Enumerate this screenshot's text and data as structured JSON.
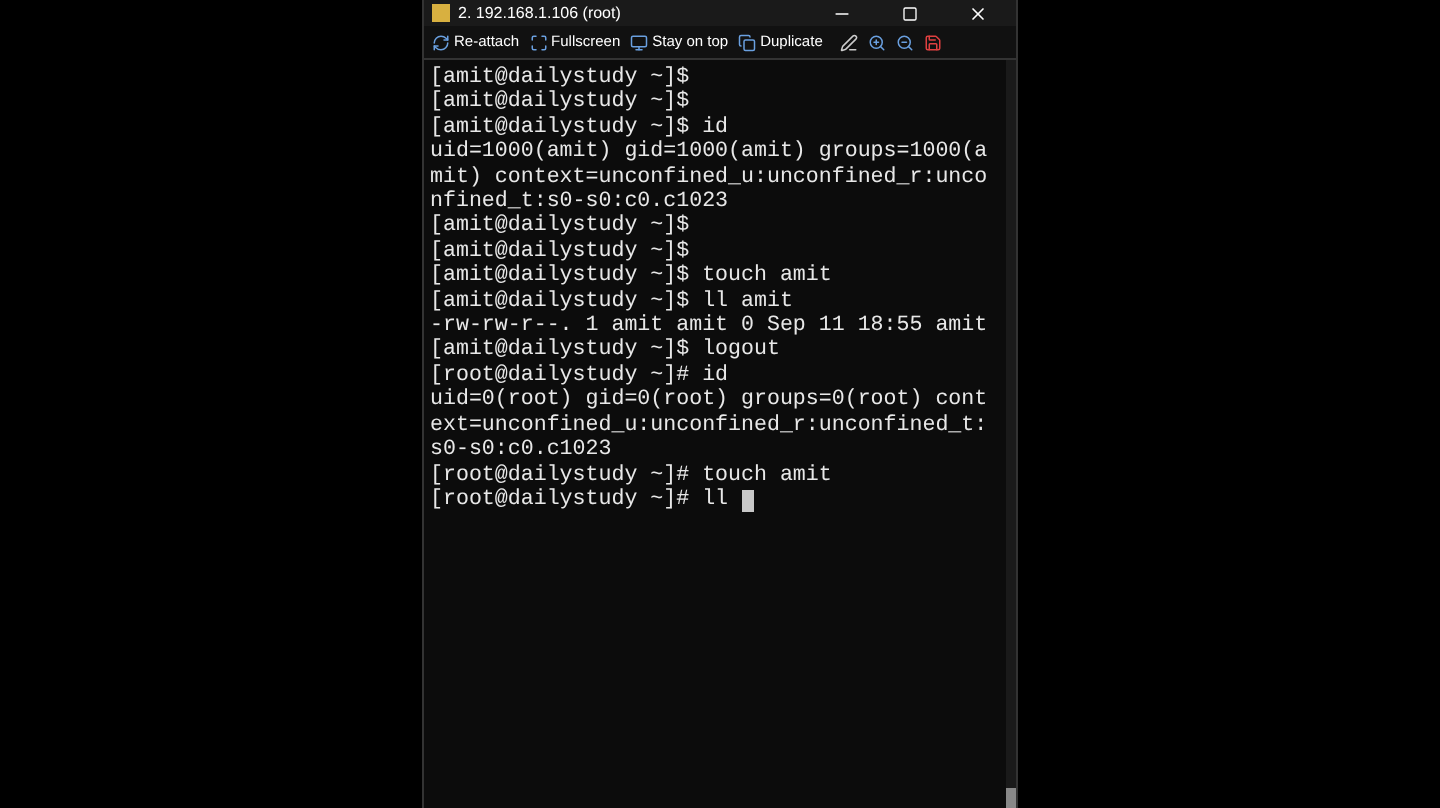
{
  "window": {
    "title": "2. 192.168.1.106 (root)"
  },
  "toolbar": [
    {
      "label": "Re-attach",
      "kind": "reattach"
    },
    {
      "label": "Fullscreen",
      "kind": "fullscreen"
    },
    {
      "label": "Stay on top",
      "kind": "ontop"
    },
    {
      "label": "Duplicate",
      "kind": "duplicate"
    }
  ],
  "terminal": {
    "lines": [
      "[amit@dailystudy ~]$",
      "[amit@dailystudy ~]$",
      "[amit@dailystudy ~]$ id",
      "uid=1000(amit) gid=1000(amit) groups=1000(a",
      "mit) context=unconfined_u:unconfined_r:unco",
      "nfined_t:s0-s0:c0.c1023",
      "[amit@dailystudy ~]$",
      "[amit@dailystudy ~]$",
      "[amit@dailystudy ~]$ touch amit",
      "[amit@dailystudy ~]$ ll amit",
      "-rw-rw-r--. 1 amit amit 0 Sep 11 18:55 amit",
      "[amit@dailystudy ~]$ logout",
      "[root@dailystudy ~]# id",
      "uid=0(root) gid=0(root) groups=0(root) cont",
      "ext=unconfined_u:unconfined_r:unconfined_t:",
      "s0-s0:c0.c1023",
      "[root@dailystudy ~]# touch amit",
      "[root@dailystudy ~]# ll "
    ],
    "cursor_visible": true
  }
}
